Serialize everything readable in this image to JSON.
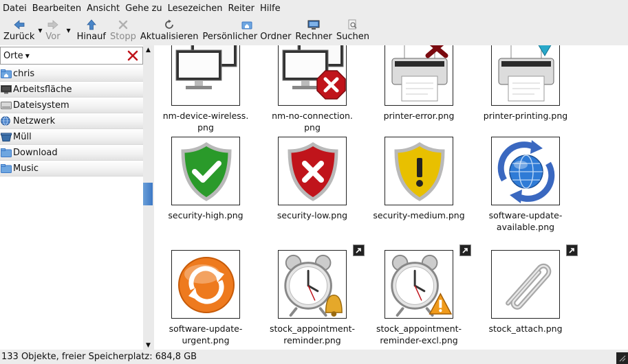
{
  "menubar": {
    "items": [
      "Datei",
      "Bearbeiten",
      "Ansicht",
      "Gehe zu",
      "Lesezeichen",
      "Reiter",
      "Hilfe"
    ]
  },
  "toolbar": {
    "back": "Zurück",
    "forward": "Vor",
    "up": "Hinauf",
    "stop": "Stopp",
    "reload": "Aktualisieren",
    "home": "Persönlicher Ordner",
    "computer": "Rechner",
    "search": "Suchen"
  },
  "sidebar": {
    "header": "Orte",
    "items": [
      {
        "label": "chris",
        "icon": "home-folder-icon"
      },
      {
        "label": "Arbeitsfläche",
        "icon": "desktop-icon"
      },
      {
        "label": "Dateisystem",
        "icon": "harddisk-icon"
      },
      {
        "label": "Netzwerk",
        "icon": "network-globe-icon"
      },
      {
        "label": "Müll",
        "icon": "trash-icon"
      },
      {
        "label": "Download",
        "icon": "folder-icon"
      },
      {
        "label": "Music",
        "icon": "folder-icon"
      }
    ]
  },
  "files": [
    {
      "name1": "nm-device-wireless.",
      "name2": "png",
      "icon": "monitors-icon",
      "link": false
    },
    {
      "name1": "nm-no-connection.",
      "name2": "png",
      "icon": "monitors-error-icon",
      "link": false
    },
    {
      "name1": "printer-error.png",
      "name2": "",
      "icon": "printer-error-icon",
      "link": false
    },
    {
      "name1": "printer-printing.png",
      "name2": "",
      "icon": "printer-printing-icon",
      "link": false
    },
    {
      "name1": "security-high.png",
      "name2": "",
      "icon": "shield-check-icon",
      "link": false
    },
    {
      "name1": "security-low.png",
      "name2": "",
      "icon": "shield-x-icon",
      "link": false
    },
    {
      "name1": "security-medium.png",
      "name2": "",
      "icon": "shield-warning-icon",
      "link": false
    },
    {
      "name1": "software-update-",
      "name2": "available.png",
      "icon": "update-globe-icon",
      "link": false
    },
    {
      "name1": "software-update-",
      "name2": "urgent.png",
      "icon": "update-urgent-icon",
      "link": false
    },
    {
      "name1": "stock_appointment-",
      "name2": "reminder.png",
      "icon": "alarm-clock-bell-icon",
      "link": true
    },
    {
      "name1": "stock_appointment-",
      "name2": "reminder-excl.png",
      "icon": "alarm-clock-warning-icon",
      "link": true
    },
    {
      "name1": "stock_attach.png",
      "name2": "",
      "icon": "paperclip-icon",
      "link": true
    }
  ],
  "status": {
    "text": "133 Objekte, freier Speicherplatz: 684,8 GB"
  },
  "colors": {
    "accent": "#3c78c5",
    "error_red": "#c0141b",
    "ok_green": "#2a9a2a",
    "warn_yellow": "#e8c000"
  }
}
